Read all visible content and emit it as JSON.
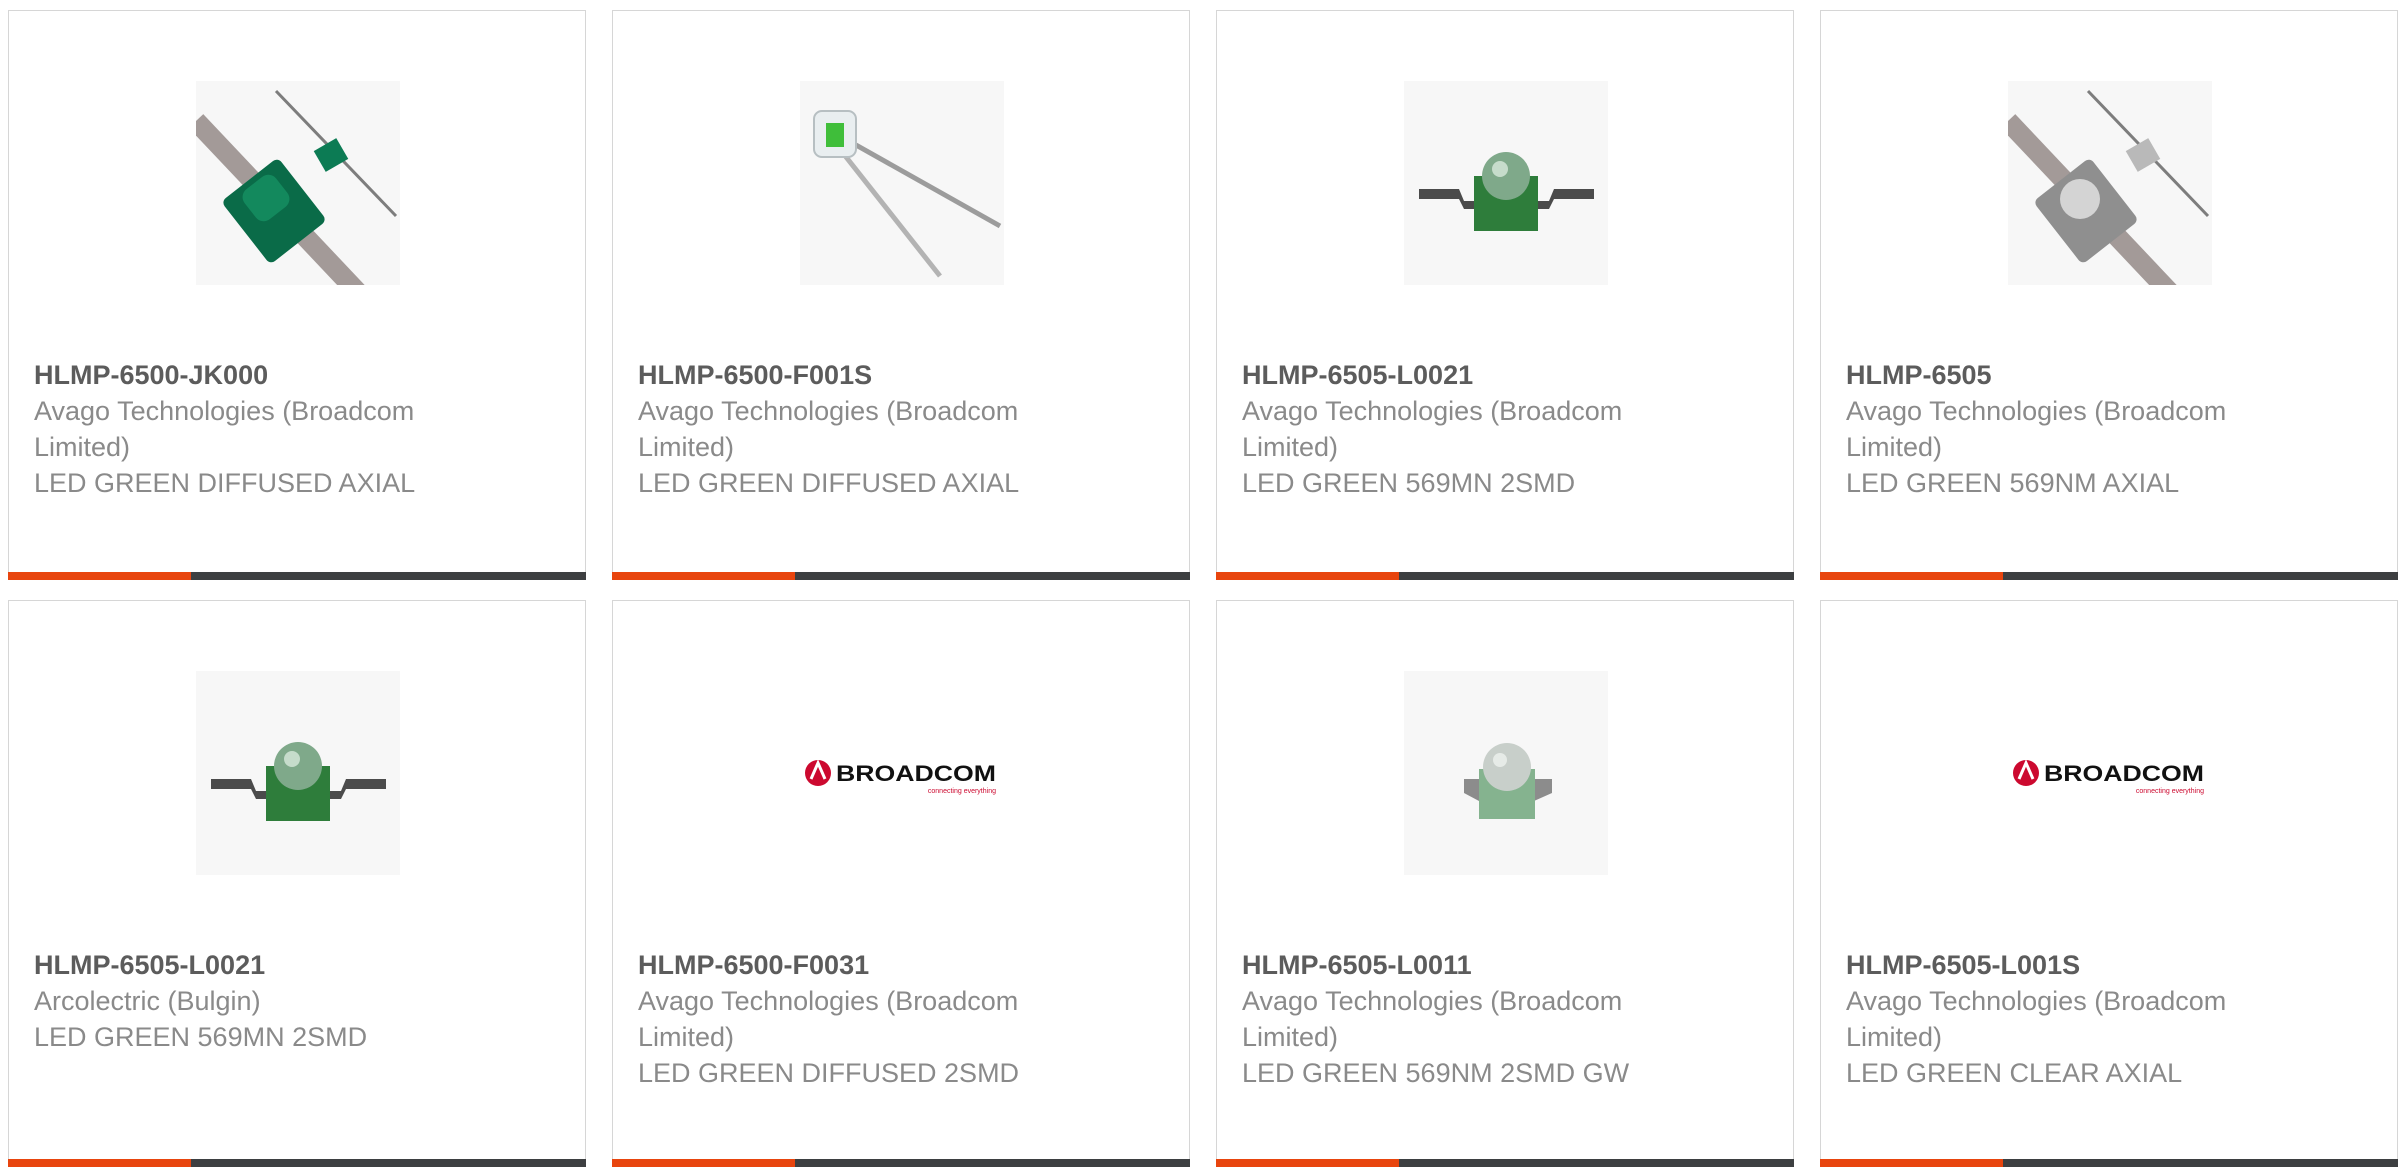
{
  "products": [
    {
      "part_number": "HLMP-6500-JK000",
      "manufacturer": "Avago Technologies (Broadcom Limited)",
      "description": "LED GREEN DIFFUSED AXIAL",
      "image_icon": "led-green-axial-tape-icon"
    },
    {
      "part_number": "HLMP-6500-F001S",
      "manufacturer": "Avago Technologies (Broadcom Limited)",
      "description": "LED GREEN DIFFUSED AXIAL",
      "image_icon": "led-green-leads-icon"
    },
    {
      "part_number": "HLMP-6505-L0021",
      "manufacturer": "Avago Technologies (Broadcom Limited)",
      "description": "LED GREEN 569MN 2SMD",
      "image_icon": "led-green-smd-icon"
    },
    {
      "part_number": "HLMP-6505",
      "manufacturer": "Avago Technologies (Broadcom Limited)",
      "description": "LED GREEN 569NM AXIAL",
      "image_icon": "led-clear-axial-tape-icon"
    },
    {
      "part_number": "HLMP-6505-L0021",
      "manufacturer": "Arcolectric (Bulgin)",
      "description": "LED GREEN 569MN 2SMD",
      "image_icon": "led-green-smd-icon"
    },
    {
      "part_number": "HLMP-6500-F0031",
      "manufacturer": "Avago Technologies (Broadcom Limited)",
      "description": "LED GREEN DIFFUSED 2SMD",
      "image_icon": "broadcom-logo"
    },
    {
      "part_number": "HLMP-6505-L0011",
      "manufacturer": "Avago Technologies (Broadcom Limited)",
      "description": "LED GREEN 569NM 2SMD GW",
      "image_icon": "led-clear-smd-icon"
    },
    {
      "part_number": "HLMP-6505-L001S",
      "manufacturer": "Avago Technologies (Broadcom Limited)",
      "description": "LED GREEN CLEAR AXIAL",
      "image_icon": "broadcom-logo"
    }
  ],
  "logo": {
    "brand": "BROADCOM",
    "tagline": "connecting everything"
  },
  "colors": {
    "accent": "#e8450e",
    "bar": "#3d3f41",
    "part_number_text": "#5c5c5c",
    "body_text": "#8a8a8a",
    "card_border": "#d6d6d6",
    "logo_red": "#cc092f"
  }
}
